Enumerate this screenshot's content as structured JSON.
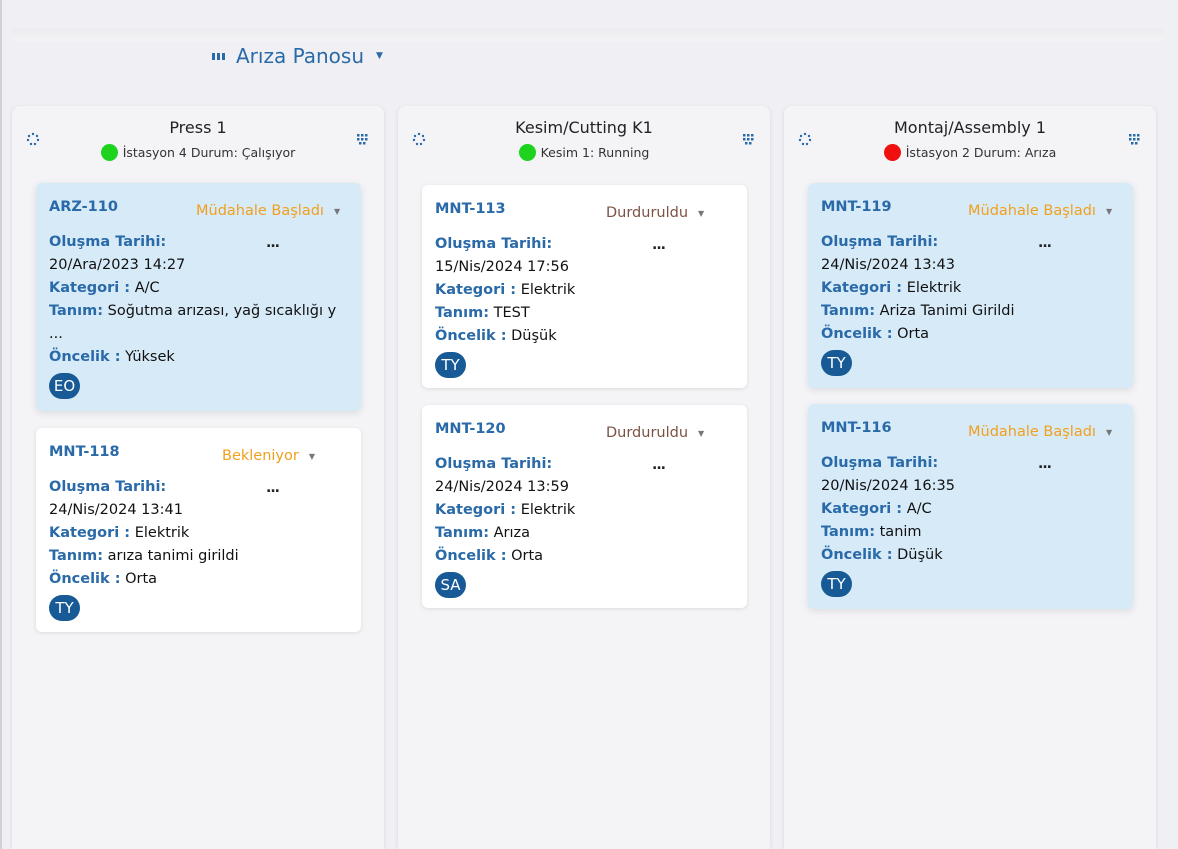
{
  "board": {
    "title": "Arıza Panosu"
  },
  "columns": [
    {
      "title": "Press 1",
      "status": "İstasyon 4 Durum: Çalışıyor",
      "status_color": "#1ed31e",
      "cards": [
        {
          "code": "ARZ-110",
          "status": "Müdahale Başladı",
          "created_label": "Oluşma Tarihi:",
          "created": "20/Ara/2023 14:27",
          "category_label": "Kategori :",
          "category": "A/C",
          "desc_label": "Tanım:",
          "desc": "Soğutma arızası, yağ sıcaklığı y",
          "desc_more": "...",
          "priority_label": "Öncelik :",
          "priority": "Yüksek",
          "assignee": "EO",
          "more": "..."
        },
        {
          "code": "MNT-118",
          "status": "Bekleniyor",
          "created_label": "Oluşma Tarihi:",
          "created": "24/Nis/2024 13:41",
          "category_label": "Kategori :",
          "category": "Elektrik",
          "desc_label": "Tanım:",
          "desc": "arıza tanimi girildi",
          "priority_label": "Öncelik :",
          "priority": "Orta",
          "assignee": "TY",
          "more": "..."
        }
      ]
    },
    {
      "title": "Kesim/Cutting K1",
      "status": "Kesim 1: Running",
      "status_color": "#1ed31e",
      "cards": [
        {
          "code": "MNT-113",
          "status": "Durduruldu",
          "created_label": "Oluşma Tarihi:",
          "created": "15/Nis/2024 17:56",
          "category_label": "Kategori :",
          "category": "Elektrik",
          "desc_label": "Tanım:",
          "desc": "TEST",
          "priority_label": "Öncelik :",
          "priority": "Düşük",
          "assignee": "TY",
          "more": "..."
        },
        {
          "code": "MNT-120",
          "status": "Durduruldu",
          "created_label": "Oluşma Tarihi:",
          "created": "24/Nis/2024 13:59",
          "category_label": "Kategori :",
          "category": "Elektrik",
          "desc_label": "Tanım:",
          "desc": "Arıza",
          "priority_label": "Öncelik :",
          "priority": "Orta",
          "assignee": "SA",
          "more": "..."
        }
      ]
    },
    {
      "title": "Montaj/Assembly 1",
      "status": "İstasyon 2 Durum: Arıza",
      "status_color": "#f01010",
      "cards": [
        {
          "code": "MNT-119",
          "status": "Müdahale Başladı",
          "created_label": "Oluşma Tarihi:",
          "created": "24/Nis/2024 13:43",
          "category_label": "Kategori :",
          "category": "Elektrik",
          "desc_label": "Tanım:",
          "desc": "Ariza Tanimi Girildi",
          "priority_label": "Öncelik :",
          "priority": "Orta",
          "assignee": "TY",
          "more": "..."
        },
        {
          "code": "MNT-116",
          "status": "Müdahale Başladı",
          "created_label": "Oluşma Tarihi:",
          "created": "20/Nis/2024 16:35",
          "category_label": "Kategori :",
          "category": "A/C",
          "desc_label": "Tanım:",
          "desc": "tanim",
          "priority_label": "Öncelik :",
          "priority": "Düşük",
          "assignee": "TY",
          "more": "..."
        }
      ]
    }
  ],
  "colors": {
    "accent": "#2a6aa8",
    "status_started": "#f0a01e",
    "status_stopped": "#7b5244",
    "status_waiting": "#f0a01e",
    "card_highlight": "#d7eaf8",
    "avatar": "#175a96"
  }
}
